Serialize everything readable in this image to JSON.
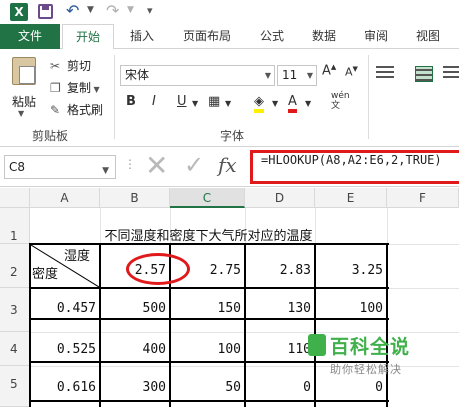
{
  "qat": {
    "app_icon": "X",
    "icons": [
      "excel-icon",
      "save-icon",
      "undo-icon",
      "redo-icon",
      "customize-qat-icon"
    ]
  },
  "tabs": [
    "文件",
    "开始",
    "插入",
    "页面布局",
    "公式",
    "数据",
    "审阅",
    "视图"
  ],
  "ribbon": {
    "clipboard": {
      "paste": "粘贴",
      "cut": "剪切",
      "copy": "复制",
      "format_painter": "格式刷",
      "group": "剪贴板"
    },
    "font": {
      "name": "宋体",
      "size": "11",
      "bold": "B",
      "italic": "I",
      "underline": "U",
      "wen": "wén",
      "group": "字体"
    }
  },
  "formula_bar": {
    "name_box": "C8",
    "formula": "=HLOOKUP(A8,A2:E6,2,TRUE)"
  },
  "grid": {
    "columns": [
      "A",
      "B",
      "C",
      "D",
      "E",
      "F"
    ],
    "selected_column": "C",
    "rows": [
      "1",
      "2",
      "3",
      "4",
      "5"
    ],
    "title": "不同湿度和密度下大气所对应的温度",
    "header_humidity": "湿度",
    "header_density": "密度",
    "row2": [
      "2.57",
      "2.75",
      "2.83",
      "3.25"
    ],
    "row3": [
      "0.457",
      "500",
      "150",
      "130",
      "100"
    ],
    "row4": [
      "0.525",
      "400",
      "100",
      "110",
      ""
    ],
    "row5": [
      "0.616",
      "300",
      "50",
      "0",
      "0"
    ]
  },
  "watermark": {
    "title": "百科全说",
    "subtitle": "助你轻松解决"
  },
  "colors": {
    "excel_green": "#217346",
    "highlight_red": "#e0191b",
    "watermark_green": "#3fb04a"
  }
}
